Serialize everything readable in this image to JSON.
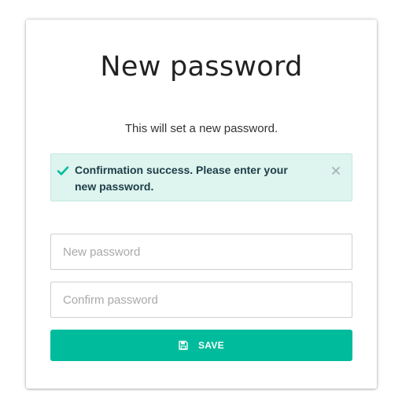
{
  "form": {
    "title": "New password",
    "subtitle": "This will set a new password.",
    "new_password_placeholder": "New password",
    "confirm_password_placeholder": "Confirm password",
    "save_label": "SAVE"
  },
  "alert": {
    "message": "Confirmation success. Please enter your new password.",
    "icon": "checkmark-icon",
    "close_icon": "close-icon"
  },
  "colors": {
    "accent": "#00bc9c",
    "alert_background": "#ddf4ef",
    "alert_text": "#1e3d47"
  }
}
